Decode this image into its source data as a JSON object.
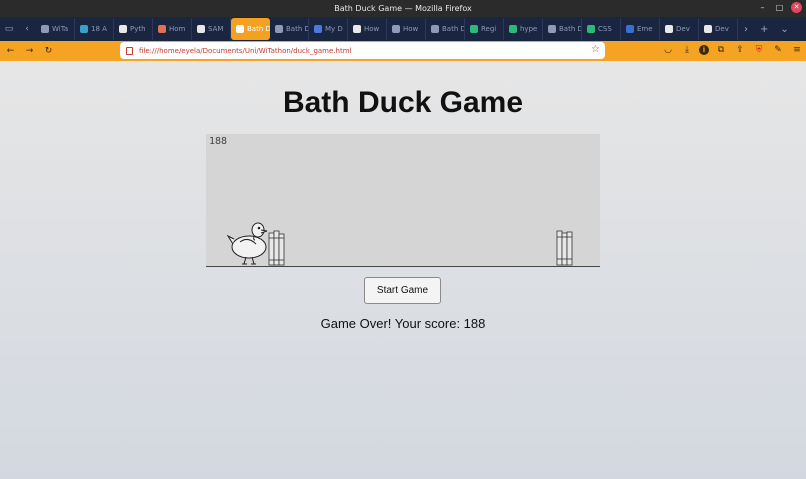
{
  "window": {
    "title": "Bath Duck Game — Mozilla Firefox"
  },
  "tabs": [
    {
      "label": "WiTa",
      "color": "#8e9ab7",
      "active": false
    },
    {
      "label": "18 A",
      "color": "#3aa0c8",
      "active": false
    },
    {
      "label": "Pyth",
      "color": "#e8e8e8",
      "active": false
    },
    {
      "label": "Hom",
      "color": "#e07050",
      "active": false
    },
    {
      "label": "SAM",
      "color": "#e8e8e8",
      "active": false
    },
    {
      "label": "Bath D",
      "color": "#ffffff",
      "active": true
    },
    {
      "label": "Bath Du",
      "color": "#8e9ab7",
      "active": false
    },
    {
      "label": "My D",
      "color": "#4a7ae0",
      "active": false
    },
    {
      "label": "How",
      "color": "#e8e8e8",
      "active": false
    },
    {
      "label": "How",
      "color": "#8e9ab7",
      "active": false
    },
    {
      "label": "Bath Du",
      "color": "#8e9ab7",
      "active": false
    },
    {
      "label": "Regi",
      "color": "#2eb87a",
      "active": false
    },
    {
      "label": "hype",
      "color": "#2eb87a",
      "active": false
    },
    {
      "label": "Bath Du",
      "color": "#8e9ab7",
      "active": false
    },
    {
      "label": "CSS",
      "color": "#2eb87a",
      "active": false
    },
    {
      "label": "Eme",
      "color": "#3a6ed0",
      "active": false
    },
    {
      "label": "Dev",
      "color": "#e8e8e8",
      "active": false
    },
    {
      "label": "Dev",
      "color": "#e8e8e8",
      "active": false
    }
  ],
  "nav": {
    "url": "file:///home/eyela/Documents/Uni/WiTathon/duck_game.html"
  },
  "game": {
    "title": "Bath Duck Game",
    "canvas_score": "188",
    "start_button": "Start Game",
    "result_text": "Game Over! Your score: 188"
  },
  "colors": {
    "accent": "#f5a323",
    "tab_bar": "#1a2540",
    "url_text": "#c23b2e"
  }
}
